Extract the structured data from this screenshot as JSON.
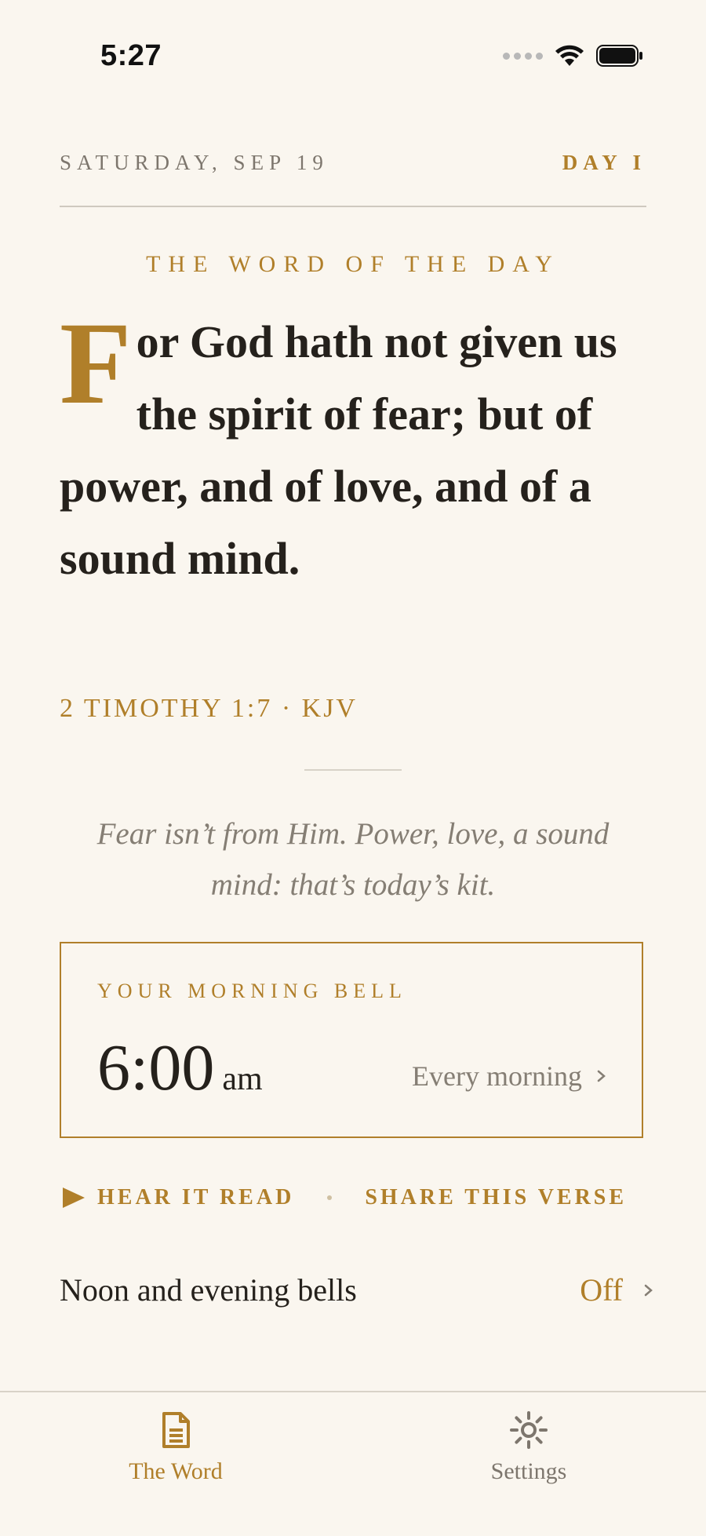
{
  "status_bar": {
    "time": "5:27"
  },
  "header": {
    "date": "SATURDAY, SEP 19",
    "day": "DAY I"
  },
  "section_title": "THE WORD OF THE DAY",
  "verse": {
    "drop_cap": "F",
    "text": "or God hath not given us the spirit of fear; but of power, and of love, and of a sound mind.",
    "citation": "2 TIMOTHY 1:7 · KJV"
  },
  "reflection": "Fear isn’t from Him. Power, love, a sound mind: that’s today’s kit.",
  "bell": {
    "label": "YOUR MORNING BELL",
    "time": "6:00",
    "ampm": "am",
    "repeat": "Every morning"
  },
  "actions": {
    "hear": "HEAR IT READ",
    "share": "SHARE THIS VERSE"
  },
  "extra_bells": {
    "label": "Noon and evening bells",
    "value": "Off"
  },
  "tabs": [
    {
      "label": "The Word",
      "icon": "document-icon",
      "active": true
    },
    {
      "label": "Settings",
      "icon": "gear-icon",
      "active": false
    }
  ],
  "colors": {
    "background": "#faf6ef",
    "accent": "#b07f2a",
    "text": "#25211c",
    "muted": "#857e74"
  }
}
